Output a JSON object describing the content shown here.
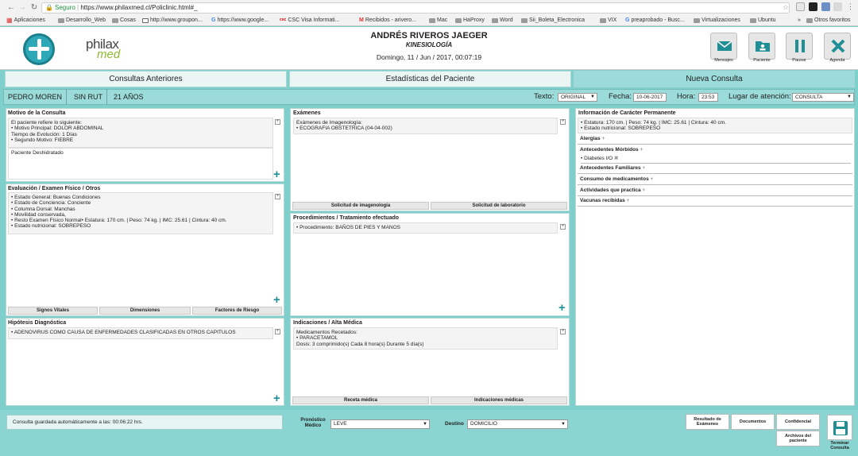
{
  "browser": {
    "secure_label": "Seguro",
    "url": "https://www.philaxmed.cl/Policlinic.html#_",
    "bookmarks": [
      "Aplicaciones",
      "Desarrollo_Web",
      "Cosas",
      "http://www.groupon...",
      "https://www.google...",
      "CSC Visa Informati...",
      "Recibidos - arivero...",
      "Mac",
      "HaProxy",
      "Word",
      "Sii_Boleta_Electronica",
      "VIX",
      "preaprobado - Busc...",
      "Virtualizaciones",
      "Ubuntu"
    ],
    "more_bookmarks": "»",
    "other_favorites": "Otros favoritos"
  },
  "header": {
    "brand_top": "philax",
    "brand_bottom": "med",
    "doctor_name": "ANDRÉS RIVEROS JAEGER",
    "specialty": "KINESIOLOGÍA",
    "datetime": "Domingo, 11 / Jun / 2017, 00:07:19",
    "toolbar": [
      "Mensajes",
      "Paciente",
      "Pausar",
      "Agenda"
    ]
  },
  "tabs": [
    "Consultas Anteriores",
    "Estadísticas del Paciente",
    "Nueva Consulta"
  ],
  "patient": {
    "name": "PEDRO MOREN",
    "rut": "SIN RUT",
    "age": "21 AÑOS",
    "texto_label": "Texto:",
    "texto_value": "ORIGINAL",
    "fecha_label": "Fecha:",
    "fecha_value": "10-06-2017",
    "hora_label": "Hora:",
    "hora_value": "23:53",
    "lugar_label": "Lugar de atención:",
    "lugar_value": "CONSULTA"
  },
  "motivo": {
    "title": "Motivo de la Consulta",
    "text": "El paciente refiere lo siguiente:\n• Motivo Principal: DOLOR ABDOMINAL\nTiempo de Evolución: 1 Días\n• Segundo Motivo: FIEBRE",
    "note": "Paciente Deshidratado"
  },
  "evaluacion": {
    "title": "Evaluación / Examen Físico / Otros",
    "text": "• Estado General: Buenas Condiciones\n• Estado de Conciencia: Conciente\n• Columna Dorsal: Manchas\n• Movilidad conservada,\n• Resto Examen Físico Normal• Estatura: 170 cm. | Peso: 74 kg. | IMC: 25.61 | Cintura: 40 cm.\n• Estado nutricional: SOBREPESO",
    "buttons": [
      "Signos Vitales",
      "Dimensiones",
      "Factores de Riesgo"
    ]
  },
  "hipotesis": {
    "title": "Hipótesis Diagnóstica",
    "text": "• ADENOVIRUS COMO CAUSA DE ENFERMEDADES CLASIFICADAS EN OTROS CAPITULOS"
  },
  "examenes": {
    "title": "Exámenes",
    "text": "Exámenes de Imagenología:\n• ECOGRAFIA OBSTETRICA (04-04-002)",
    "buttons": [
      "Solicitud de imagenología",
      "Solicitud de laboratorio"
    ]
  },
  "procedimientos": {
    "title": "Procedimientos / Tratamiento efectuado",
    "text": "• Procedimiento: BAÑOS DE PIES Y MANOS"
  },
  "indicaciones": {
    "title": "Indicaciones / Alta Médica",
    "text": "Medicamentos Recetados:\n• PARACETAMOL\nDosis: 3 comprimido(s) Cada 8 hora(s) Durante 5 día(s)",
    "buttons": [
      "Receta médica",
      "Indicaciones médicas"
    ]
  },
  "info_permanente": {
    "title": "Información de Carácter Permanente",
    "text": "• Estatura: 170 cm. | Peso: 74 kg. | IMC: 25.61 | Cintura: 40 cm.\n• Estado nutricional: SOBREPESO",
    "sections": [
      "Alergias",
      "Antecedentes Mórbidos",
      "Antecedentes Familiares",
      "Consumo de medicamentos",
      "Actividades que practica",
      "Vacunas recibidas"
    ],
    "morbidos_item": "• Diabetes I/O"
  },
  "footer": {
    "autosave": "Consulta guardada automáticamente a las: 00:06:22 hrs.",
    "pronostico_label_1": "Pronóstico",
    "pronostico_label_2": "Médico",
    "pronostico_value": "LEVE",
    "destino_label": "Destino",
    "destino_value": "DOMICILIO",
    "buttons": [
      "Resultado de Exámenes",
      "Documentos",
      "Confidencial",
      "Archivos del paciente"
    ],
    "finish_1": "Terminar",
    "finish_2": "Consulta"
  }
}
